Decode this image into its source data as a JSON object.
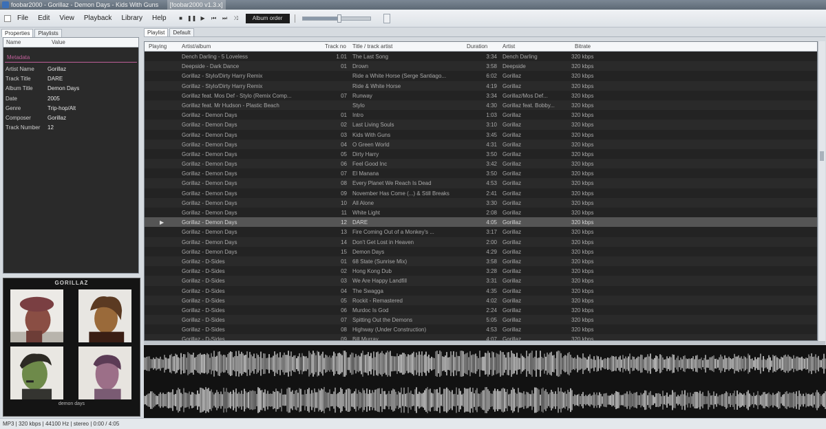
{
  "window": {
    "title": "foobar2000 - Gorillaz - Demon Days - Kids With Guns",
    "title_extra": "[foobar2000 v1.3.x]"
  },
  "menu": [
    "File",
    "Edit",
    "View",
    "Playback",
    "Library",
    "Help"
  ],
  "toolbar": {
    "buttons": [
      "stop-icon",
      "pause-icon",
      "play-icon",
      "prev-icon",
      "next-icon",
      "random-icon"
    ],
    "seek_label": "Album order",
    "volume_fraction": 0.55
  },
  "left_tabs": [
    "Properties",
    "Playlists"
  ],
  "properties": {
    "header_name": "Name",
    "header_value": "Value",
    "group": "Metadata",
    "rows": [
      {
        "name": "Artist Name",
        "value": "Gorillaz"
      },
      {
        "name": "Track Title",
        "value": "DARE"
      },
      {
        "name": "Album Title",
        "value": "Demon Days"
      },
      {
        "name": "Date",
        "value": "2005"
      },
      {
        "name": "Genre",
        "value": "Trip-hop/Alt"
      },
      {
        "name": "Composer",
        "value": "Gorillaz"
      },
      {
        "name": "Track Number",
        "value": "12"
      }
    ]
  },
  "album_art": {
    "title": "GORILLAZ",
    "caption": "demon days"
  },
  "playlist_tabs": [
    "Playlist",
    "Default"
  ],
  "playlist": {
    "columns": {
      "playing": "Playing",
      "album": "Artist/album",
      "track": "Track no",
      "title": "Title / track artist",
      "duration": "Duration",
      "artist": "Artist",
      "bitrate": "Bitrate"
    },
    "rows": [
      {
        "playing": "",
        "album": "Dench Darling - 5 Loveless",
        "track": "1.01",
        "title": "The Last Song",
        "duration": "3:34",
        "artist": "Dench Darling",
        "bitrate": "320 kbps"
      },
      {
        "playing": "",
        "album": "Deepside - Dark Dance",
        "track": "01",
        "title": "Drown",
        "duration": "3:58",
        "artist": "Deepside",
        "bitrate": "320 kbps"
      },
      {
        "playing": "",
        "album": "Gorillaz - Stylo/Dirty Harry Remix",
        "track": "",
        "title": "Ride a White Horse (Serge Santiago...",
        "duration": "6:02",
        "artist": "Gorillaz",
        "bitrate": "320 kbps"
      },
      {
        "playing": "",
        "album": "Gorillaz - Stylo/Dirty Harry Remix",
        "track": "",
        "title": "Ride & White Horse",
        "duration": "4:19",
        "artist": "Gorillaz",
        "bitrate": "320 kbps"
      },
      {
        "playing": "",
        "album": "Gorillaz feat. Mos Def - Stylo (Remix Comp...",
        "track": "07",
        "title": "Runway",
        "duration": "3:34",
        "artist": "Gorillaz/Mos Def...",
        "bitrate": "320 kbps"
      },
      {
        "playing": "",
        "album": "Gorillaz feat. Mr Hudson - Plastic Beach",
        "track": "",
        "title": "Stylo",
        "duration": "4:30",
        "artist": "Gorillaz feat. Bobby...",
        "bitrate": "320 kbps"
      },
      {
        "playing": "",
        "album": "Gorillaz - Demon Days",
        "track": "01",
        "title": "Intro",
        "duration": "1:03",
        "artist": "Gorillaz",
        "bitrate": "320 kbps"
      },
      {
        "playing": "",
        "album": "Gorillaz - Demon Days",
        "track": "02",
        "title": "Last Living Souls",
        "duration": "3:10",
        "artist": "Gorillaz",
        "bitrate": "320 kbps"
      },
      {
        "playing": "",
        "album": "Gorillaz - Demon Days",
        "track": "03",
        "title": "Kids With Guns",
        "duration": "3:45",
        "artist": "Gorillaz",
        "bitrate": "320 kbps"
      },
      {
        "playing": "",
        "album": "Gorillaz - Demon Days",
        "track": "04",
        "title": "O Green World",
        "duration": "4:31",
        "artist": "Gorillaz",
        "bitrate": "320 kbps"
      },
      {
        "playing": "",
        "album": "Gorillaz - Demon Days",
        "track": "05",
        "title": "Dirty Harry",
        "duration": "3:50",
        "artist": "Gorillaz",
        "bitrate": "320 kbps"
      },
      {
        "playing": "",
        "album": "Gorillaz - Demon Days",
        "track": "06",
        "title": "Feel Good Inc",
        "duration": "3:42",
        "artist": "Gorillaz",
        "bitrate": "320 kbps"
      },
      {
        "playing": "",
        "album": "Gorillaz - Demon Days",
        "track": "07",
        "title": "El Manana",
        "duration": "3:50",
        "artist": "Gorillaz",
        "bitrate": "320 kbps"
      },
      {
        "playing": "",
        "album": "Gorillaz - Demon Days",
        "track": "08",
        "title": "Every Planet We Reach Is Dead",
        "duration": "4:53",
        "artist": "Gorillaz",
        "bitrate": "320 kbps"
      },
      {
        "playing": "",
        "album": "Gorillaz - Demon Days",
        "track": "09",
        "title": "November Has Come (...) & Still Breaks",
        "duration": "2:41",
        "artist": "Gorillaz",
        "bitrate": "320 kbps"
      },
      {
        "playing": "",
        "album": "Gorillaz - Demon Days",
        "track": "10",
        "title": "All Alone",
        "duration": "3:30",
        "artist": "Gorillaz",
        "bitrate": "320 kbps"
      },
      {
        "playing": "",
        "album": "Gorillaz - Demon Days",
        "track": "11",
        "title": "White Light",
        "duration": "2:08",
        "artist": "Gorillaz",
        "bitrate": "320 kbps"
      },
      {
        "playing": "▶",
        "album": "Gorillaz - Demon Days",
        "track": "12",
        "title": "DARE",
        "duration": "4:05",
        "artist": "Gorillaz",
        "bitrate": "320 kbps"
      },
      {
        "playing": "",
        "album": "Gorillaz - Demon Days",
        "track": "13",
        "title": "Fire Coming Out of a Monkey's ...",
        "duration": "3:17",
        "artist": "Gorillaz",
        "bitrate": "320 kbps"
      },
      {
        "playing": "",
        "album": "Gorillaz - Demon Days",
        "track": "14",
        "title": "Don't Get Lost in Heaven",
        "duration": "2:00",
        "artist": "Gorillaz",
        "bitrate": "320 kbps"
      },
      {
        "playing": "",
        "album": "Gorillaz - Demon Days",
        "track": "15",
        "title": "Demon Days",
        "duration": "4:29",
        "artist": "Gorillaz",
        "bitrate": "320 kbps"
      },
      {
        "playing": "",
        "album": "Gorillaz - D-Sides",
        "track": "01",
        "title": "68 State (Sunrise Mix)",
        "duration": "3:58",
        "artist": "Gorillaz",
        "bitrate": "320 kbps"
      },
      {
        "playing": "",
        "album": "Gorillaz - D-Sides",
        "track": "02",
        "title": "Hong Kong Dub",
        "duration": "3:28",
        "artist": "Gorillaz",
        "bitrate": "320 kbps"
      },
      {
        "playing": "",
        "album": "Gorillaz - D-Sides",
        "track": "03",
        "title": "We Are Happy Landfill",
        "duration": "3:31",
        "artist": "Gorillaz",
        "bitrate": "320 kbps"
      },
      {
        "playing": "",
        "album": "Gorillaz - D-Sides",
        "track": "04",
        "title": "The Swagga",
        "duration": "4:35",
        "artist": "Gorillaz",
        "bitrate": "320 kbps"
      },
      {
        "playing": "",
        "album": "Gorillaz - D-Sides",
        "track": "05",
        "title": "Rockit - Remastered",
        "duration": "4:02",
        "artist": "Gorillaz",
        "bitrate": "320 kbps"
      },
      {
        "playing": "",
        "album": "Gorillaz - D-Sides",
        "track": "06",
        "title": "Murdoc Is God",
        "duration": "2:24",
        "artist": "Gorillaz",
        "bitrate": "320 kbps"
      },
      {
        "playing": "",
        "album": "Gorillaz - D-Sides",
        "track": "07",
        "title": "Spitting Out the Demons",
        "duration": "5:05",
        "artist": "Gorillaz",
        "bitrate": "320 kbps"
      },
      {
        "playing": "",
        "album": "Gorillaz - D-Sides",
        "track": "08",
        "title": "Highway (Under Construction)",
        "duration": "4:53",
        "artist": "Gorillaz",
        "bitrate": "320 kbps"
      },
      {
        "playing": "",
        "album": "Gorillaz - D-Sides",
        "track": "09",
        "title": "Bill Murray",
        "duration": "4:07",
        "artist": "Gorillaz",
        "bitrate": "320 kbps"
      }
    ]
  },
  "status": "MP3 | 320 kbps | 44100 Hz | stereo | 0:00 / 4:05",
  "colors": {
    "playlist_bg": "#1f1f1f",
    "group_title": "#c0609a",
    "playing_row": "#555555"
  }
}
